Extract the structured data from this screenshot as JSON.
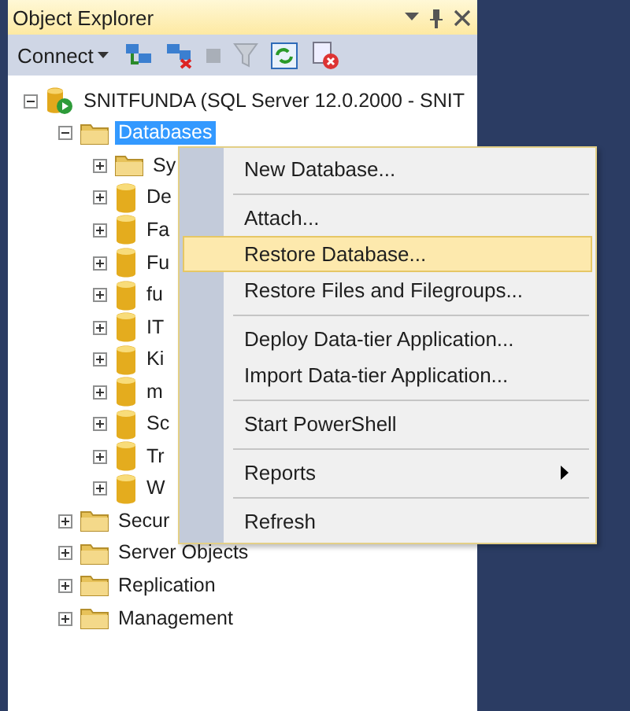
{
  "panel": {
    "title": "Object Explorer"
  },
  "toolbar": {
    "connect": "Connect"
  },
  "tree": [
    {
      "kind": "server",
      "label": "SNITFUNDA (SQL Server 12.0.2000 - SNIT",
      "selected": false,
      "expanded": true,
      "children": [
        {
          "kind": "folder",
          "label": "Databases",
          "selected": true,
          "expanded": true,
          "children": [
            {
              "kind": "folder",
              "label": "Sy",
              "selected": false,
              "expanded": false
            },
            {
              "kind": "database",
              "label": "De",
              "selected": false,
              "expanded": false
            },
            {
              "kind": "database",
              "label": "Fa",
              "selected": false,
              "expanded": false
            },
            {
              "kind": "database",
              "label": "Fu",
              "selected": false,
              "expanded": false
            },
            {
              "kind": "database",
              "label": "fu",
              "selected": false,
              "expanded": false
            },
            {
              "kind": "database",
              "label": "IT",
              "selected": false,
              "expanded": false
            },
            {
              "kind": "database",
              "label": "Ki",
              "selected": false,
              "expanded": false
            },
            {
              "kind": "database",
              "label": "m",
              "selected": false,
              "expanded": false
            },
            {
              "kind": "database",
              "label": "Sc",
              "selected": false,
              "expanded": false
            },
            {
              "kind": "database",
              "label": "Tr",
              "selected": false,
              "expanded": false
            },
            {
              "kind": "database",
              "label": "W",
              "selected": false,
              "expanded": false
            }
          ]
        },
        {
          "kind": "folder",
          "label": "Secur",
          "selected": false,
          "expanded": false
        },
        {
          "kind": "folder",
          "label": "Server Objects",
          "selected": false,
          "expanded": false
        },
        {
          "kind": "folder",
          "label": "Replication",
          "selected": false,
          "expanded": false
        },
        {
          "kind": "folder",
          "label": "Management",
          "selected": false,
          "expanded": false
        }
      ]
    }
  ],
  "context_menu": {
    "groups": [
      [
        {
          "label": "New Database...",
          "selected": false,
          "submenu": false
        }
      ],
      [
        {
          "label": "Attach...",
          "selected": false,
          "submenu": false
        },
        {
          "label": "Restore Database...",
          "selected": true,
          "submenu": false
        },
        {
          "label": "Restore Files and Filegroups...",
          "selected": false,
          "submenu": false
        }
      ],
      [
        {
          "label": "Deploy Data-tier Application...",
          "selected": false,
          "submenu": false
        },
        {
          "label": "Import Data-tier Application...",
          "selected": false,
          "submenu": false
        }
      ],
      [
        {
          "label": "Start PowerShell",
          "selected": false,
          "submenu": false
        }
      ],
      [
        {
          "label": "Reports",
          "selected": false,
          "submenu": true
        }
      ],
      [
        {
          "label": "Refresh",
          "selected": false,
          "submenu": false
        }
      ]
    ]
  }
}
